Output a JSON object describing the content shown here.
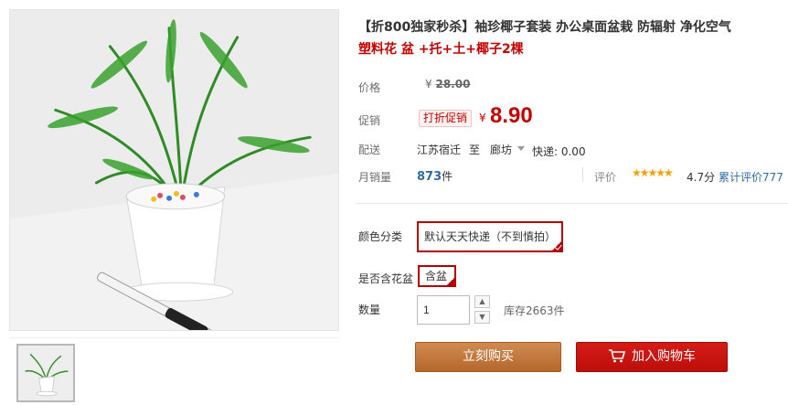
{
  "product": {
    "title_line1": "【折800独家秒杀】袖珍椰子套装 办公桌面盆栽 防辐射 净化空气",
    "title_line2": "塑料花 盆 +托+土+椰子2棵"
  },
  "price": {
    "label": "价格",
    "currency": "¥",
    "original": "28.00"
  },
  "promo": {
    "label": "促销",
    "tag": "打折促销",
    "currency": "¥",
    "price": "8.90"
  },
  "shipping": {
    "label": "配送",
    "from": "江苏宿迁",
    "to_word": "至",
    "to_city": "廊坊",
    "fee": "快递: 0.00"
  },
  "sales": {
    "label": "月销量",
    "count": "873",
    "unit": "件",
    "rating_label": "评价",
    "stars": "★★★★★",
    "rating_score": "4.7分",
    "reviews": "累计评价777"
  },
  "options": {
    "color_label": "颜色分类",
    "color_value": "默认天天快递（不到慎拍）",
    "pot_label": "是否含花盆",
    "pot_value": "含盆"
  },
  "quantity": {
    "label": "数量",
    "value": "1",
    "up": "▲",
    "down": "▼",
    "stock": "库存2663件"
  },
  "actions": {
    "buy_now": "立刻购买",
    "add_cart": "加入购物车"
  },
  "colors": {
    "accent_red": "#c40000",
    "buy_orange": "#c27a40",
    "cart_red": "#c8140f",
    "link_blue": "#2e6da4",
    "star_gold": "#f1a100"
  },
  "icons": {
    "cart": "cart-icon",
    "caret": "chevron-down-icon",
    "check": "check-corner-icon"
  }
}
